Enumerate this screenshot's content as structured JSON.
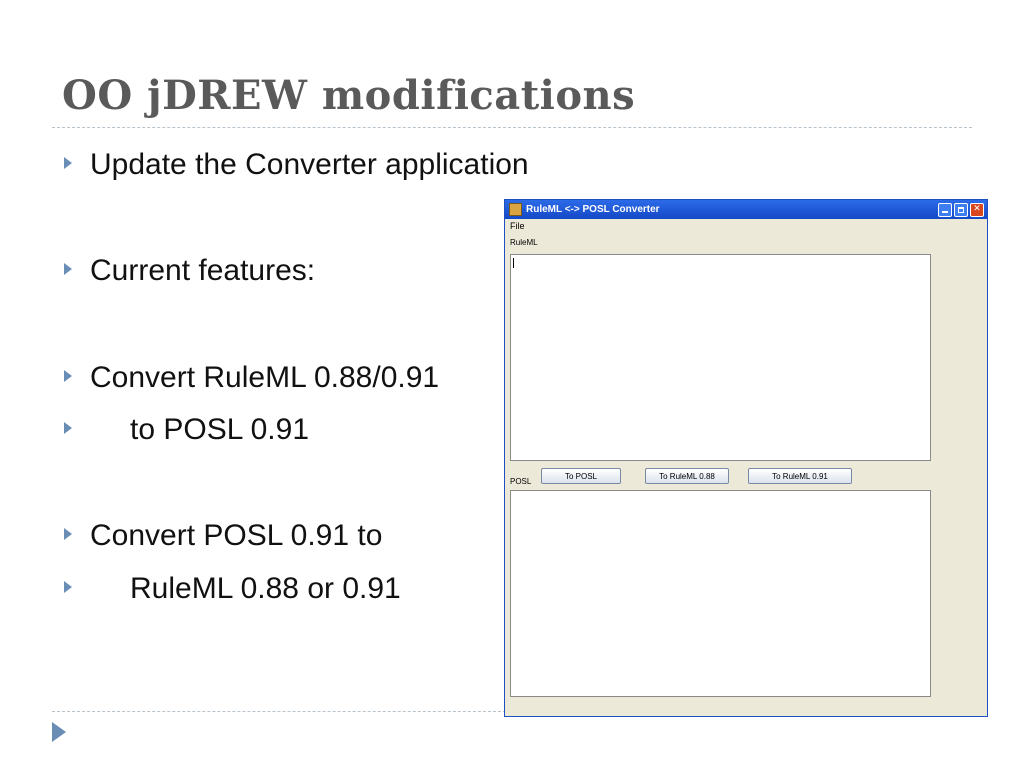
{
  "slide": {
    "title": "OO jDREW modifications",
    "bullets": [
      {
        "text": "Update the Converter application",
        "indent": false
      },
      {
        "text": "Current features:",
        "indent": false
      },
      {
        "text": "Convert RuleML 0.88/0.91",
        "indent": false
      },
      {
        "text": "to POSL 0.91",
        "indent": true
      },
      {
        "text": "Convert POSL 0.91 to",
        "indent": false
      },
      {
        "text": "RuleML 0.88 or 0.91",
        "indent": true
      }
    ]
  },
  "window": {
    "title": "RuleML <-> POSL Converter",
    "menu": {
      "file": "File"
    },
    "ruleml_label": "RuleML",
    "posl_label": "POSL",
    "buttons": {
      "to_posl": "To POSL",
      "to_ruleml_088": "To RuleML 0.88",
      "to_ruleml_091": "To RuleML 0.91"
    }
  },
  "colors": {
    "title": "#5a5a5a",
    "bullet_arrow": "#6a8db5",
    "titlebar": "#1448c7",
    "window_bg": "#ece9d8"
  },
  "icons": [
    "bullet-arrow-icon",
    "app-icon",
    "minimize-icon",
    "maximize-icon",
    "close-icon",
    "slide-nav-arrow-icon"
  ]
}
